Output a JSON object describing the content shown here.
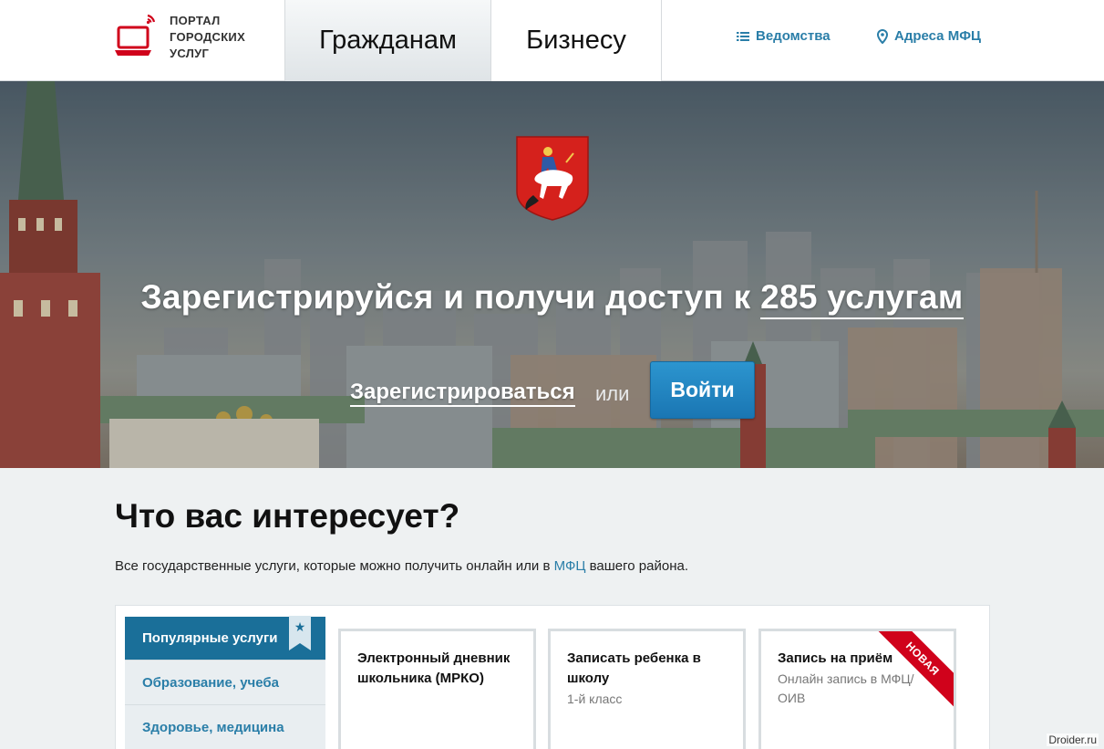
{
  "header": {
    "logo_lines": [
      "ПОРТАЛ",
      "ГОРОДСКИХ",
      "УСЛУГ"
    ],
    "tabs": [
      {
        "label": "Гражданам",
        "active": true
      },
      {
        "label": "Бизнесу",
        "active": false
      }
    ],
    "links": {
      "departments": "Ведомства",
      "mfc_addresses": "Адреса МФЦ"
    }
  },
  "hero": {
    "title_prefix": "Зарегистрируйся и получи доступ к",
    "title_count": "285 услугам",
    "register_label": "Зарегистрироваться",
    "or_text": "или",
    "login_label": "Войти"
  },
  "content": {
    "title": "Что вас интересует?",
    "desc_before": "Все государственные услуги, которые можно получить онлайн или в",
    "desc_link": "МФЦ",
    "desc_after": "вашего района."
  },
  "sidebar": {
    "items": [
      {
        "label": "Популярные услуги",
        "active": true
      },
      {
        "label": "Образование, учеба",
        "active": false
      },
      {
        "label": "Здоровье, медицина",
        "active": false
      }
    ],
    "star_icon": "★"
  },
  "cards": [
    {
      "title": "Электронный дневник школьника (МРКО)",
      "subtitle": ""
    },
    {
      "title": "Записать ребенка в школу",
      "subtitle": "1-й класс"
    },
    {
      "title": "Запись на приём",
      "subtitle": "Онлайн запись в МФЦ/ ОИВ",
      "badge": "НОВАЯ"
    }
  ],
  "watermark": "Droider.ru",
  "colors": {
    "accent": "#2a7ea8",
    "active_sidebar": "#1a6f99",
    "login_button": "#1e82bf",
    "badge": "#d0021b"
  }
}
